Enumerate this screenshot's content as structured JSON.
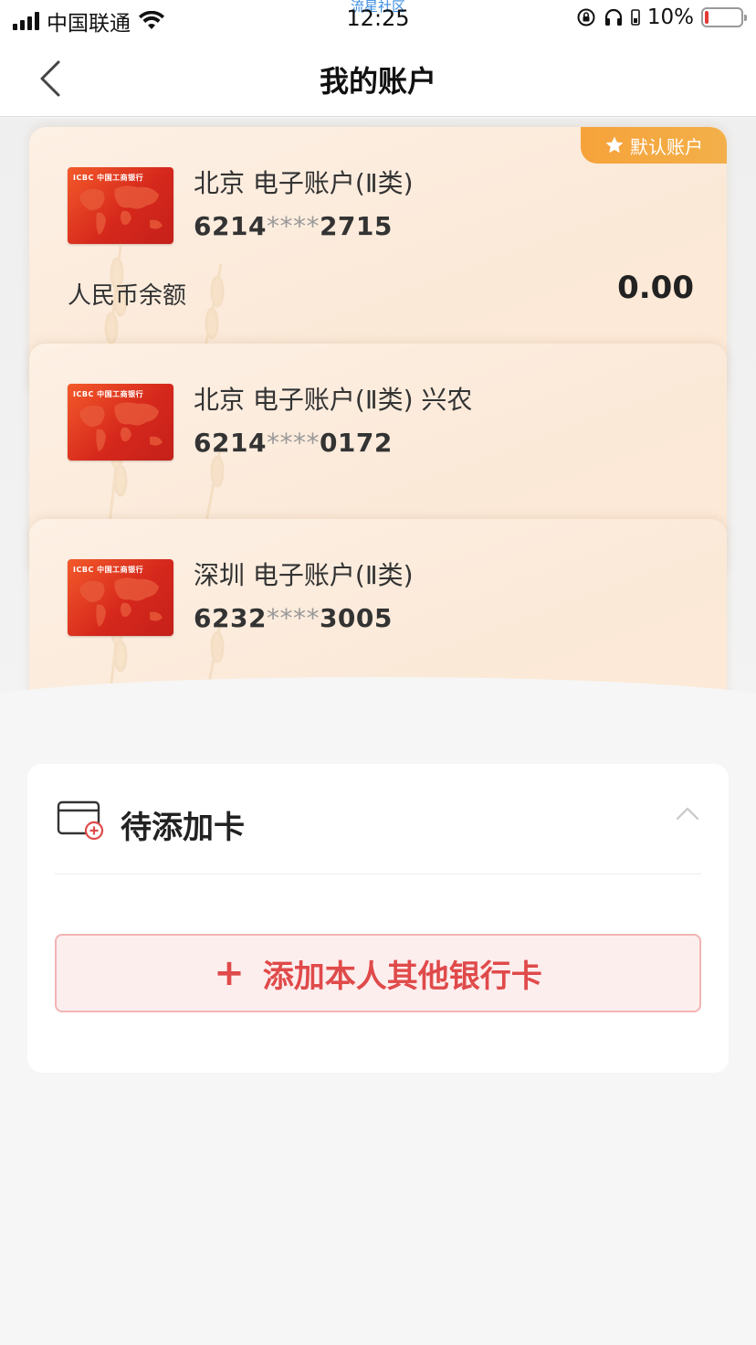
{
  "status_bar": {
    "carrier": "中国联通",
    "watermark": "流星社区",
    "time": "12:25",
    "battery": "10%"
  },
  "nav": {
    "title": "我的账户"
  },
  "accounts": [
    {
      "name": "北京 电子账户(Ⅱ类)",
      "num_prefix": "6214",
      "num_mask": "****",
      "num_suffix": "2715",
      "balance_label": "人民币余额",
      "balance": "0.00",
      "badge": "默认账户",
      "bank_label": "ICBC 中国工商银行"
    },
    {
      "name": "北京 电子账户(Ⅱ类) 兴农",
      "num_prefix": "6214",
      "num_mask": "****",
      "num_suffix": "0172",
      "bank_label": "ICBC 中国工商银行"
    },
    {
      "name": "深圳 电子账户(Ⅱ类)",
      "num_prefix": "6232",
      "num_mask": "****",
      "num_suffix": "3005",
      "bank_label": "ICBC 中国工商银行"
    }
  ],
  "pending": {
    "title": "待添加卡",
    "add_button_label": "添加本人其他银行卡",
    "add_button_plus": "+"
  },
  "colors": {
    "accent_red": "#e04a4a",
    "badge_orange": "#f6a23a",
    "card_bg": "#fbe9d8"
  }
}
